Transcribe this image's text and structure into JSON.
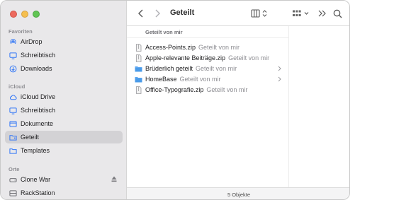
{
  "window": {
    "title": "Geteilt",
    "status": "5 Objekte"
  },
  "sidebar": {
    "sections": [
      {
        "title": "Favoriten",
        "items": [
          {
            "label": "AirDrop",
            "icon": "airdrop-icon"
          },
          {
            "label": "Schreibtisch",
            "icon": "desktop-icon"
          },
          {
            "label": "Downloads",
            "icon": "download-icon"
          }
        ]
      },
      {
        "title": "iCloud",
        "items": [
          {
            "label": "iCloud Drive",
            "icon": "cloud-icon"
          },
          {
            "label": "Schreibtisch",
            "icon": "desktop-icon"
          },
          {
            "label": "Dokumente",
            "icon": "document-icon"
          },
          {
            "label": "Geteilt",
            "icon": "shared-folder-icon",
            "active": true
          },
          {
            "label": "Templates",
            "icon": "folder-icon"
          }
        ]
      },
      {
        "title": "Orte",
        "items": [
          {
            "label": "Clone War",
            "icon": "disk-icon",
            "eject": true
          },
          {
            "label": "RackStation",
            "icon": "server-icon"
          }
        ]
      }
    ]
  },
  "list": {
    "header": "Geteilt von mir",
    "rows": [
      {
        "name": "Access-Points.zip",
        "sub": "Geteilt von mir",
        "kind": "zip"
      },
      {
        "name": "Apple-relevante Beiträge.zip",
        "sub": "Geteilt von mir",
        "kind": "zip"
      },
      {
        "name": "Brüderlich geteilt",
        "sub": "Geteilt von mir",
        "kind": "folder"
      },
      {
        "name": "HomeBase",
        "sub": "Geteilt von mir",
        "kind": "folder"
      },
      {
        "name": "Office-Typografie.zip",
        "sub": "Geteilt von mir",
        "kind": "zip"
      }
    ]
  },
  "colors": {
    "accent": "#3478f6",
    "sidebar_bg": "#e9e8ea",
    "selection": "#d3d2d5"
  }
}
